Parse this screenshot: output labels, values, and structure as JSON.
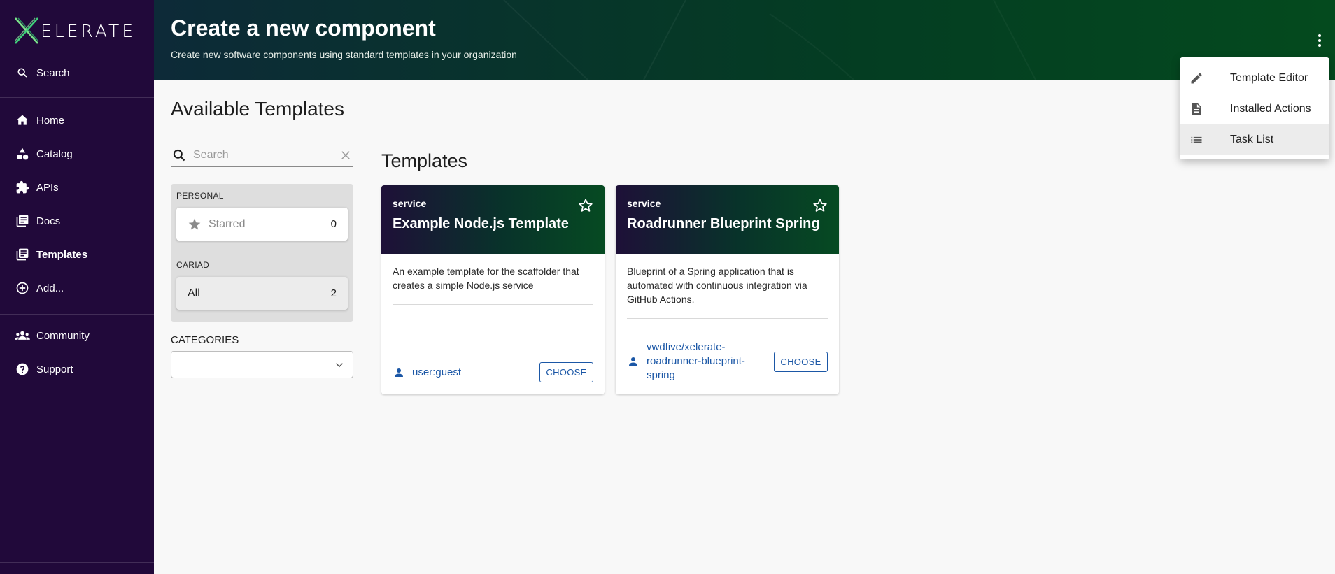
{
  "app": {
    "logo_text": "ELERATE"
  },
  "sidebar": {
    "search_label": "Search",
    "items": [
      {
        "label": "Home",
        "icon": "home-icon"
      },
      {
        "label": "Catalog",
        "icon": "catalog-icon"
      },
      {
        "label": "APIs",
        "icon": "puzzle-icon"
      },
      {
        "label": "Docs",
        "icon": "docs-icon"
      },
      {
        "label": "Templates",
        "icon": "templates-icon",
        "active": true
      },
      {
        "label": "Add...",
        "icon": "add-circle-icon"
      }
    ],
    "secondary_items": [
      {
        "label": "Community",
        "icon": "community-icon"
      },
      {
        "label": "Support",
        "icon": "help-icon"
      }
    ]
  },
  "header": {
    "title": "Create a new component",
    "subtitle": "Create new software components using standard templates in your organization"
  },
  "main": {
    "title": "Available Templates",
    "search_placeholder": "Search",
    "filters": {
      "personal_label": "PERSONAL",
      "starred_label": "Starred",
      "starred_count": "0",
      "org_label": "CARIAD",
      "all_label": "All",
      "all_count": "2"
    },
    "categories_label": "CATEGORIES",
    "templates_title": "Templates",
    "cards": [
      {
        "type": "service",
        "title": "Example Node.js Template",
        "description": "An example template for the scaffolder that creates a simple Node.js service",
        "owner": "user:guest",
        "choose_label": "CHOOSE"
      },
      {
        "type": "service",
        "title": "Roadrunner Blueprint Spring",
        "description": "Blueprint of a Spring application that is automated with continuous integration via GitHub Actions.",
        "owner": "vwdfive/xelerate-roadrunner-blueprint-spring",
        "choose_label": "CHOOSE"
      }
    ]
  },
  "menu": {
    "items": [
      {
        "label": "Template Editor",
        "icon": "pencil-icon"
      },
      {
        "label": "Installed Actions",
        "icon": "document-icon"
      },
      {
        "label": "Task List",
        "icon": "list-icon",
        "hovered": true
      }
    ]
  },
  "colors": {
    "sidebar_bg": "#21093a",
    "header_green": "#044a1e",
    "link_blue": "#1b57a6",
    "logo_green": "#2ecc71"
  }
}
